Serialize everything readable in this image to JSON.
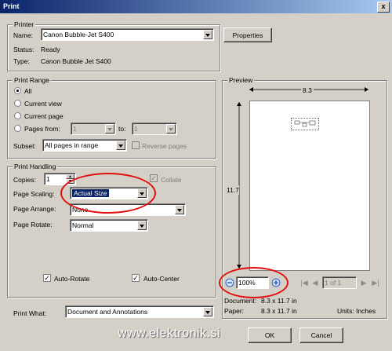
{
  "window": {
    "title": "Print",
    "close_glyph": "x"
  },
  "printer": {
    "group_title": "Printer",
    "name_label": "Name:",
    "name_value": "Canon Bubble-Jet S400",
    "properties_button": "Properties",
    "status_label": "Status:",
    "status_value": "Ready",
    "type_label": "Type:",
    "type_value": "Canon Bubble Jet S400"
  },
  "print_range": {
    "group_title": "Print Range",
    "all": "All",
    "current_view": "Current view",
    "current_page": "Current page",
    "pages_from": "Pages from:",
    "from_value": "1",
    "to_label": "to:",
    "to_value": "1",
    "subset_label": "Subset:",
    "subset_value": "All pages in range",
    "reverse_pages": "Reverse pages"
  },
  "print_handling": {
    "group_title": "Print Handling",
    "copies_label": "Copies:",
    "copies_value": "1",
    "collate": "Collate",
    "page_scaling_label": "Page Scaling:",
    "page_scaling_value": "Actual Size",
    "page_arrange_label": "Page Arrange:",
    "page_arrange_value": "None",
    "page_rotate_label": "Page Rotate:",
    "page_rotate_value": "Normal",
    "auto_rotate": "Auto-Rotate",
    "auto_center": "Auto-Center"
  },
  "print_what": {
    "label": "Print What:",
    "value": "Document and Annotations"
  },
  "preview": {
    "group_title": "Preview",
    "width_label": "8.3",
    "height_label": "11.7",
    "zoom_value": "100%",
    "page_indicator": "1 of 1",
    "document_label": "Document:",
    "document_value": "8.3 x 11.7 in",
    "paper_label": "Paper:",
    "paper_value": "8.3 x 11.7 in",
    "units_label": "Units: Inches",
    "zoom_out_glyph": "−",
    "zoom_in_glyph": "+"
  },
  "buttons": {
    "ok": "OK",
    "cancel": "Cancel"
  },
  "watermark": "www.elektronik.si",
  "colors": {
    "title_bar": "#0a246a",
    "highlight": "#0a246a",
    "annotation": "#e01010",
    "zoom_icon": "#3060c0"
  }
}
